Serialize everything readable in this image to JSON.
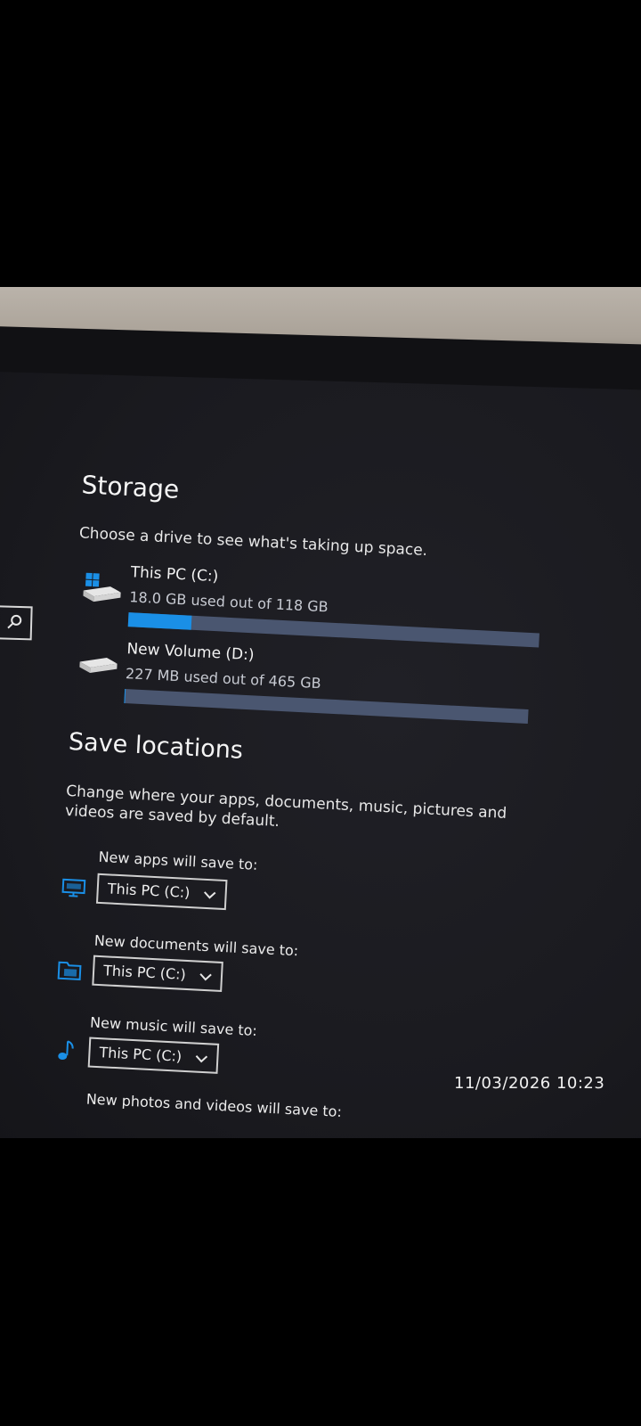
{
  "storage": {
    "title": "Storage",
    "description": "Choose a drive to see what's taking up space.",
    "drives": [
      {
        "name": "This PC (C:)",
        "usage": "18.0 GB used out of 118 GB",
        "used_fraction": 0.153
      },
      {
        "name": "New Volume (D:)",
        "usage": "227 MB used out of 465 GB",
        "used_fraction": 0.0005
      }
    ]
  },
  "save_locations": {
    "title": "Save locations",
    "description": "Change where your apps, documents, music, pictures and videos are saved by default.",
    "items": [
      {
        "label": "New apps will save to:",
        "value": "This PC (C:)",
        "icon": "monitor-icon"
      },
      {
        "label": "New documents will save to:",
        "value": "This PC (C:)",
        "icon": "folder-icon"
      },
      {
        "label": "New music will save to:",
        "value": "This PC (C:)",
        "icon": "music-note-icon"
      },
      {
        "label": "New photos and videos will save to:",
        "icon": "photo-icon"
      }
    ]
  },
  "photo_timestamp": "11/03/2026 10:23",
  "colors": {
    "accent": "#1a8fe6",
    "bar_track": "#4a5670",
    "background": "#1b1b1f"
  }
}
